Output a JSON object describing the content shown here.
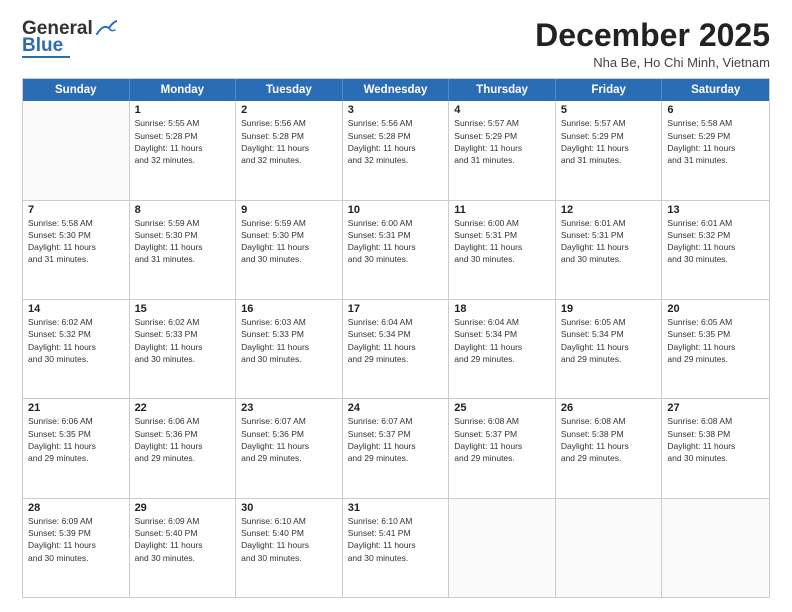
{
  "header": {
    "logo_general": "General",
    "logo_blue": "Blue",
    "month_title": "December 2025",
    "location": "Nha Be, Ho Chi Minh, Vietnam"
  },
  "calendar": {
    "days_of_week": [
      "Sunday",
      "Monday",
      "Tuesday",
      "Wednesday",
      "Thursday",
      "Friday",
      "Saturday"
    ],
    "rows": [
      [
        {
          "day": "",
          "sunrise": "",
          "sunset": "",
          "daylight": ""
        },
        {
          "day": "1",
          "sunrise": "Sunrise: 5:55 AM",
          "sunset": "Sunset: 5:28 PM",
          "daylight": "Daylight: 11 hours and 32 minutes."
        },
        {
          "day": "2",
          "sunrise": "Sunrise: 5:56 AM",
          "sunset": "Sunset: 5:28 PM",
          "daylight": "Daylight: 11 hours and 32 minutes."
        },
        {
          "day": "3",
          "sunrise": "Sunrise: 5:56 AM",
          "sunset": "Sunset: 5:28 PM",
          "daylight": "Daylight: 11 hours and 32 minutes."
        },
        {
          "day": "4",
          "sunrise": "Sunrise: 5:57 AM",
          "sunset": "Sunset: 5:29 PM",
          "daylight": "Daylight: 11 hours and 31 minutes."
        },
        {
          "day": "5",
          "sunrise": "Sunrise: 5:57 AM",
          "sunset": "Sunset: 5:29 PM",
          "daylight": "Daylight: 11 hours and 31 minutes."
        },
        {
          "day": "6",
          "sunrise": "Sunrise: 5:58 AM",
          "sunset": "Sunset: 5:29 PM",
          "daylight": "Daylight: 11 hours and 31 minutes."
        }
      ],
      [
        {
          "day": "7",
          "sunrise": "Sunrise: 5:58 AM",
          "sunset": "Sunset: 5:30 PM",
          "daylight": "Daylight: 11 hours and 31 minutes."
        },
        {
          "day": "8",
          "sunrise": "Sunrise: 5:59 AM",
          "sunset": "Sunset: 5:30 PM",
          "daylight": "Daylight: 11 hours and 31 minutes."
        },
        {
          "day": "9",
          "sunrise": "Sunrise: 5:59 AM",
          "sunset": "Sunset: 5:30 PM",
          "daylight": "Daylight: 11 hours and 30 minutes."
        },
        {
          "day": "10",
          "sunrise": "Sunrise: 6:00 AM",
          "sunset": "Sunset: 5:31 PM",
          "daylight": "Daylight: 11 hours and 30 minutes."
        },
        {
          "day": "11",
          "sunrise": "Sunrise: 6:00 AM",
          "sunset": "Sunset: 5:31 PM",
          "daylight": "Daylight: 11 hours and 30 minutes."
        },
        {
          "day": "12",
          "sunrise": "Sunrise: 6:01 AM",
          "sunset": "Sunset: 5:31 PM",
          "daylight": "Daylight: 11 hours and 30 minutes."
        },
        {
          "day": "13",
          "sunrise": "Sunrise: 6:01 AM",
          "sunset": "Sunset: 5:32 PM",
          "daylight": "Daylight: 11 hours and 30 minutes."
        }
      ],
      [
        {
          "day": "14",
          "sunrise": "Sunrise: 6:02 AM",
          "sunset": "Sunset: 5:32 PM",
          "daylight": "Daylight: 11 hours and 30 minutes."
        },
        {
          "day": "15",
          "sunrise": "Sunrise: 6:02 AM",
          "sunset": "Sunset: 5:33 PM",
          "daylight": "Daylight: 11 hours and 30 minutes."
        },
        {
          "day": "16",
          "sunrise": "Sunrise: 6:03 AM",
          "sunset": "Sunset: 5:33 PM",
          "daylight": "Daylight: 11 hours and 30 minutes."
        },
        {
          "day": "17",
          "sunrise": "Sunrise: 6:04 AM",
          "sunset": "Sunset: 5:34 PM",
          "daylight": "Daylight: 11 hours and 29 minutes."
        },
        {
          "day": "18",
          "sunrise": "Sunrise: 6:04 AM",
          "sunset": "Sunset: 5:34 PM",
          "daylight": "Daylight: 11 hours and 29 minutes."
        },
        {
          "day": "19",
          "sunrise": "Sunrise: 6:05 AM",
          "sunset": "Sunset: 5:34 PM",
          "daylight": "Daylight: 11 hours and 29 minutes."
        },
        {
          "day": "20",
          "sunrise": "Sunrise: 6:05 AM",
          "sunset": "Sunset: 5:35 PM",
          "daylight": "Daylight: 11 hours and 29 minutes."
        }
      ],
      [
        {
          "day": "21",
          "sunrise": "Sunrise: 6:06 AM",
          "sunset": "Sunset: 5:35 PM",
          "daylight": "Daylight: 11 hours and 29 minutes."
        },
        {
          "day": "22",
          "sunrise": "Sunrise: 6:06 AM",
          "sunset": "Sunset: 5:36 PM",
          "daylight": "Daylight: 11 hours and 29 minutes."
        },
        {
          "day": "23",
          "sunrise": "Sunrise: 6:07 AM",
          "sunset": "Sunset: 5:36 PM",
          "daylight": "Daylight: 11 hours and 29 minutes."
        },
        {
          "day": "24",
          "sunrise": "Sunrise: 6:07 AM",
          "sunset": "Sunset: 5:37 PM",
          "daylight": "Daylight: 11 hours and 29 minutes."
        },
        {
          "day": "25",
          "sunrise": "Sunrise: 6:08 AM",
          "sunset": "Sunset: 5:37 PM",
          "daylight": "Daylight: 11 hours and 29 minutes."
        },
        {
          "day": "26",
          "sunrise": "Sunrise: 6:08 AM",
          "sunset": "Sunset: 5:38 PM",
          "daylight": "Daylight: 11 hours and 29 minutes."
        },
        {
          "day": "27",
          "sunrise": "Sunrise: 6:08 AM",
          "sunset": "Sunset: 5:38 PM",
          "daylight": "Daylight: 11 hours and 30 minutes."
        }
      ],
      [
        {
          "day": "28",
          "sunrise": "Sunrise: 6:09 AM",
          "sunset": "Sunset: 5:39 PM",
          "daylight": "Daylight: 11 hours and 30 minutes."
        },
        {
          "day": "29",
          "sunrise": "Sunrise: 6:09 AM",
          "sunset": "Sunset: 5:40 PM",
          "daylight": "Daylight: 11 hours and 30 minutes."
        },
        {
          "day": "30",
          "sunrise": "Sunrise: 6:10 AM",
          "sunset": "Sunset: 5:40 PM",
          "daylight": "Daylight: 11 hours and 30 minutes."
        },
        {
          "day": "31",
          "sunrise": "Sunrise: 6:10 AM",
          "sunset": "Sunset: 5:41 PM",
          "daylight": "Daylight: 11 hours and 30 minutes."
        },
        {
          "day": "",
          "sunrise": "",
          "sunset": "",
          "daylight": ""
        },
        {
          "day": "",
          "sunrise": "",
          "sunset": "",
          "daylight": ""
        },
        {
          "day": "",
          "sunrise": "",
          "sunset": "",
          "daylight": ""
        }
      ]
    ]
  }
}
